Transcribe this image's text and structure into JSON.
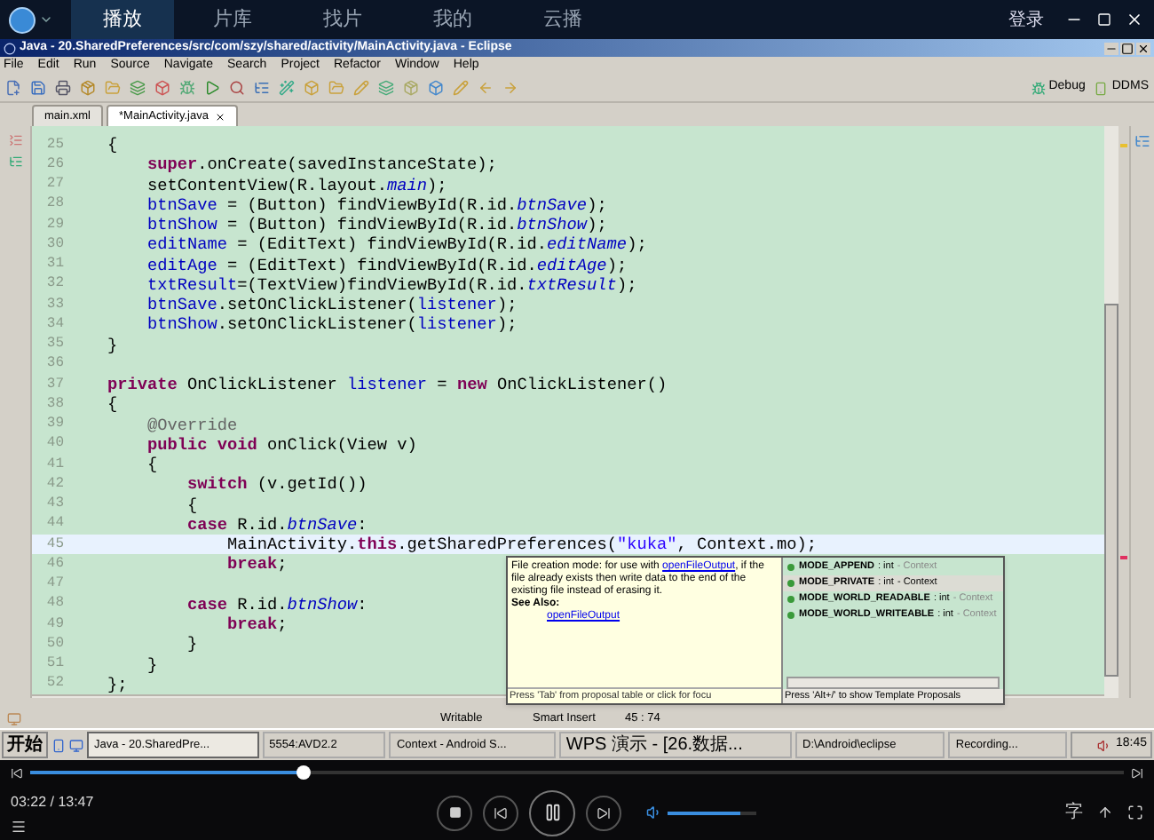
{
  "player": {
    "tabs": [
      {
        "label": "播放",
        "selected": true
      },
      {
        "label": "片库",
        "selected": false
      },
      {
        "label": "找片",
        "selected": false
      },
      {
        "label": "我的",
        "selected": false
      },
      {
        "label": "云播",
        "selected": false
      }
    ],
    "login": "登录"
  },
  "window": {
    "title": "Java - 20.SharedPreferences/src/com/szy/shared/activity/MainActivity.java - Eclipse"
  },
  "menu": [
    "File",
    "Edit",
    "Run",
    "Source",
    "Navigate",
    "Search",
    "Project",
    "Refactor",
    "Window",
    "Help"
  ],
  "perspectives": [
    "Debug",
    "DDMS"
  ],
  "editor_tabs": [
    {
      "label": "main.xml",
      "selected": false
    },
    {
      "label": "*MainActivity.java",
      "selected": true
    }
  ],
  "code": [
    {
      "number": "25",
      "current": false,
      "tokens": [
        {
          "kind": "plain",
          "text": "    {"
        }
      ]
    },
    {
      "number": "26",
      "current": false,
      "tokens": [
        {
          "kind": "kw",
          "text": "        super"
        },
        {
          "kind": "plain",
          "text": ".onCreate(savedInstanceState);"
        }
      ]
    },
    {
      "number": "27",
      "current": false,
      "tokens": [
        {
          "kind": "plain",
          "text": "        setContentView(R.layout."
        },
        {
          "kind": "static",
          "text": "main"
        },
        {
          "kind": "plain",
          "text": ");"
        }
      ]
    },
    {
      "number": "28",
      "current": false,
      "tokens": [
        {
          "kind": "field",
          "text": "        btnSave"
        },
        {
          "kind": "plain",
          "text": " = (Button) findViewById(R.id."
        },
        {
          "kind": "static",
          "text": "btnSave"
        },
        {
          "kind": "plain",
          "text": ");"
        }
      ]
    },
    {
      "number": "29",
      "current": false,
      "tokens": [
        {
          "kind": "field",
          "text": "        btnShow"
        },
        {
          "kind": "plain",
          "text": " = (Button) findViewById(R.id."
        },
        {
          "kind": "static",
          "text": "btnShow"
        },
        {
          "kind": "plain",
          "text": ");"
        }
      ]
    },
    {
      "number": "30",
      "current": false,
      "tokens": [
        {
          "kind": "field",
          "text": "        editName"
        },
        {
          "kind": "plain",
          "text": " = (EditText) findViewById(R.id."
        },
        {
          "kind": "static",
          "text": "editName"
        },
        {
          "kind": "plain",
          "text": ");"
        }
      ]
    },
    {
      "number": "31",
      "current": false,
      "tokens": [
        {
          "kind": "field",
          "text": "        editAge"
        },
        {
          "kind": "plain",
          "text": " = (EditText) findViewById(R.id."
        },
        {
          "kind": "static",
          "text": "editAge"
        },
        {
          "kind": "plain",
          "text": ");"
        }
      ]
    },
    {
      "number": "32",
      "current": false,
      "tokens": [
        {
          "kind": "field",
          "text": "        txtResult"
        },
        {
          "kind": "plain",
          "text": "=(TextView)findViewById(R.id."
        },
        {
          "kind": "static",
          "text": "txtResult"
        },
        {
          "kind": "plain",
          "text": ");"
        }
      ]
    },
    {
      "number": "33",
      "current": false,
      "tokens": [
        {
          "kind": "field",
          "text": "        btnSave"
        },
        {
          "kind": "plain",
          "text": ".setOnClickListener("
        },
        {
          "kind": "field",
          "text": "listener"
        },
        {
          "kind": "plain",
          "text": ");"
        }
      ]
    },
    {
      "number": "34",
      "current": false,
      "tokens": [
        {
          "kind": "field",
          "text": "        btnShow"
        },
        {
          "kind": "plain",
          "text": ".setOnClickListener("
        },
        {
          "kind": "field",
          "text": "listener"
        },
        {
          "kind": "plain",
          "text": ");"
        }
      ]
    },
    {
      "number": "35",
      "current": false,
      "tokens": [
        {
          "kind": "plain",
          "text": "    }"
        }
      ]
    },
    {
      "number": "36",
      "current": false
    },
    {
      "number": "37",
      "current": false,
      "tokens": [
        {
          "kind": "kw",
          "text": "    private"
        },
        {
          "kind": "plain",
          "text": " OnClickListener "
        },
        {
          "kind": "field",
          "text": "listener"
        },
        {
          "kind": "plain",
          "text": " = "
        },
        {
          "kind": "kw",
          "text": "new"
        },
        {
          "kind": "plain",
          "text": " OnClickListener()"
        }
      ]
    },
    {
      "number": "38",
      "current": false,
      "tokens": [
        {
          "kind": "plain",
          "text": "    {"
        }
      ]
    },
    {
      "number": "39",
      "current": false,
      "tokens": [
        {
          "kind": "annot",
          "text": "        @Override"
        }
      ]
    },
    {
      "number": "40",
      "current": false,
      "tokens": [
        {
          "kind": "kw",
          "text": "        public"
        },
        {
          "kind": "kw",
          "text": " void"
        },
        {
          "kind": "plain",
          "text": " onClick(View v)"
        }
      ]
    },
    {
      "number": "41",
      "current": false,
      "tokens": [
        {
          "kind": "plain",
          "text": "        {"
        }
      ]
    },
    {
      "number": "42",
      "current": false,
      "tokens": [
        {
          "kind": "kw",
          "text": "            switch"
        },
        {
          "kind": "plain",
          "text": " (v.getId())"
        }
      ]
    },
    {
      "number": "43",
      "current": false,
      "tokens": [
        {
          "kind": "plain",
          "text": "            {"
        }
      ]
    },
    {
      "number": "44",
      "current": false,
      "tokens": [
        {
          "kind": "kw",
          "text": "            case"
        },
        {
          "kind": "plain",
          "text": " R.id."
        },
        {
          "kind": "static",
          "text": "btnSave"
        },
        {
          "kind": "plain",
          "text": ":"
        }
      ]
    },
    {
      "number": "45",
      "current": true,
      "tokens": [
        {
          "kind": "plain",
          "text": "                MainActivity."
        },
        {
          "kind": "kw",
          "text": "this"
        },
        {
          "kind": "plain",
          "text": ".getSharedPreferences("
        },
        {
          "kind": "str",
          "text": "\"kuka\""
        },
        {
          "kind": "plain",
          "text": ", Context.mo);"
        }
      ]
    },
    {
      "number": "46",
      "current": false,
      "tokens": [
        {
          "kind": "kw",
          "text": "                break"
        },
        {
          "kind": "plain",
          "text": ";"
        }
      ]
    },
    {
      "number": "47",
      "current": false
    },
    {
      "number": "48",
      "current": false,
      "tokens": [
        {
          "kind": "kw",
          "text": "            case"
        },
        {
          "kind": "plain",
          "text": " R.id."
        },
        {
          "kind": "static",
          "text": "btnShow"
        },
        {
          "kind": "plain",
          "text": ":"
        }
      ]
    },
    {
      "number": "49",
      "current": false,
      "tokens": [
        {
          "kind": "kw",
          "text": "                break"
        },
        {
          "kind": "plain",
          "text": ";"
        }
      ]
    },
    {
      "number": "50",
      "current": false,
      "tokens": [
        {
          "kind": "plain",
          "text": "            }"
        }
      ]
    },
    {
      "number": "51",
      "current": false,
      "tokens": [
        {
          "kind": "plain",
          "text": "        }"
        }
      ]
    },
    {
      "number": "52",
      "current": false,
      "tokens": [
        {
          "kind": "plain",
          "text": "    };"
        }
      ]
    }
  ],
  "content_assist": {
    "doc": {
      "text_before": "File creation mode: for use with",
      "link": "openFileOutput",
      "text_after": ", if the file already exists then write data to the end of the existing file instead of erasing it.",
      "see_also_label": "See Also:",
      "see_also_link": "openFileOutput",
      "footer": "Press 'Tab' from proposal table or click for focu"
    },
    "proposals": [
      {
        "name": "MODE_APPEND",
        "type": ": int",
        "owner": "- Context",
        "selected": false
      },
      {
        "name": "MODE_PRIVATE",
        "type": ": int",
        "owner": "- Context",
        "selected": true
      },
      {
        "name": "MODE_WORLD_READABLE",
        "type": ": int",
        "owner": "- Context",
        "selected": false
      },
      {
        "name": "MODE_WORLD_WRITEABLE",
        "type": ": int",
        "owner": "- Context",
        "selected": false
      }
    ],
    "footer": "Press 'Alt+/' to show Template Proposals"
  },
  "status_bar": [
    "Writable",
    "Smart Insert",
    "45 : 74"
  ],
  "taskbar": {
    "start": "开始",
    "tasks": [
      {
        "label": "Java - 20.SharedPre...",
        "selected": true
      },
      {
        "label": "5554:AVD2.2",
        "selected": false
      },
      {
        "label": "Context - Android S...",
        "selected": false
      },
      {
        "label": "WPS 演示 - [26.数据...",
        "selected": false
      },
      {
        "label": "D:\\Android\\eclipse",
        "selected": false
      },
      {
        "label": "Recording...",
        "selected": false
      }
    ],
    "clock": "18:45"
  },
  "playback": {
    "progress": {
      "level": 0.25
    },
    "time": "03:22 / 13:47",
    "volume": {
      "level": 0.82
    },
    "subtitle": "字"
  }
}
